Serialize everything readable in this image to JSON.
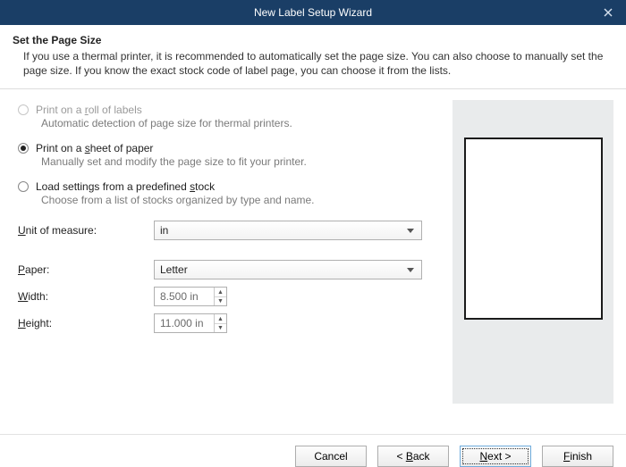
{
  "titlebar": {
    "title": "New Label Setup Wizard"
  },
  "header": {
    "title": "Set the Page Size",
    "desc": "If you use a thermal printer, it is recommended to automatically set the page size. You can also choose to manually set the page size. If you know the exact stock code of label page, you can choose it from the lists."
  },
  "options": {
    "roll": {
      "label_pre": "Print on a ",
      "label_u": "r",
      "label_post": "oll of labels",
      "desc": "Automatic detection of page size for thermal printers."
    },
    "sheet": {
      "label_pre": "Print on a ",
      "label_u": "s",
      "label_post": "heet of paper",
      "desc": "Manually set and modify the page size to fit your printer."
    },
    "stock": {
      "label_pre": "Load settings from a predefined ",
      "label_u": "s",
      "label_post": "tock",
      "desc": "Choose from a list of stocks organized by type and name."
    }
  },
  "form": {
    "unit": {
      "label_u": "U",
      "label_post": "nit of measure:",
      "value": "in"
    },
    "paper": {
      "label_u": "P",
      "label_post": "aper:",
      "value": "Letter"
    },
    "width": {
      "label_u": "W",
      "label_post": "idth:",
      "value": "8.500 in"
    },
    "height": {
      "label_u": "H",
      "label_post": "eight:",
      "value": "11.000 in"
    }
  },
  "buttons": {
    "cancel": "Cancel",
    "back_pre": "< ",
    "back_u": "B",
    "back_post": "ack",
    "next_u": "N",
    "next_post": "ext >",
    "finish_u": "F",
    "finish_post": "inish"
  }
}
